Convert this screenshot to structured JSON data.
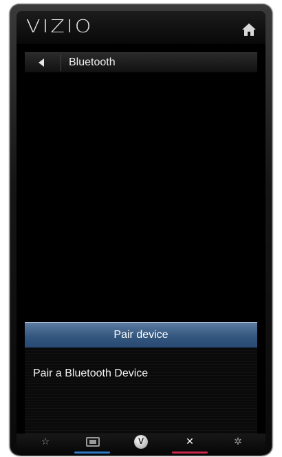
{
  "header": {
    "logo_text": "VIZIO",
    "home_icon": "home-icon"
  },
  "titlebar": {
    "back_icon": "back-arrow-icon",
    "title": "Bluetooth"
  },
  "menu": {
    "selected_item": "Pair device"
  },
  "description": {
    "text": "Pair a Bluetooth Device"
  },
  "bottom_nav": {
    "items": [
      {
        "icon": "star-icon",
        "glyph": "☆",
        "accent": ""
      },
      {
        "icon": "widescreen-icon",
        "glyph": "",
        "accent": "#2f78c4"
      },
      {
        "icon": "vizio-v-icon",
        "glyph": "V",
        "accent": ""
      },
      {
        "icon": "close-icon",
        "glyph": "✕",
        "accent": "#c8264a"
      },
      {
        "icon": "settings-icon",
        "glyph": "✲",
        "accent": ""
      }
    ]
  },
  "colors": {
    "selection": "#34577f",
    "blue_accent": "#2f78c4",
    "red_accent": "#c8264a"
  }
}
